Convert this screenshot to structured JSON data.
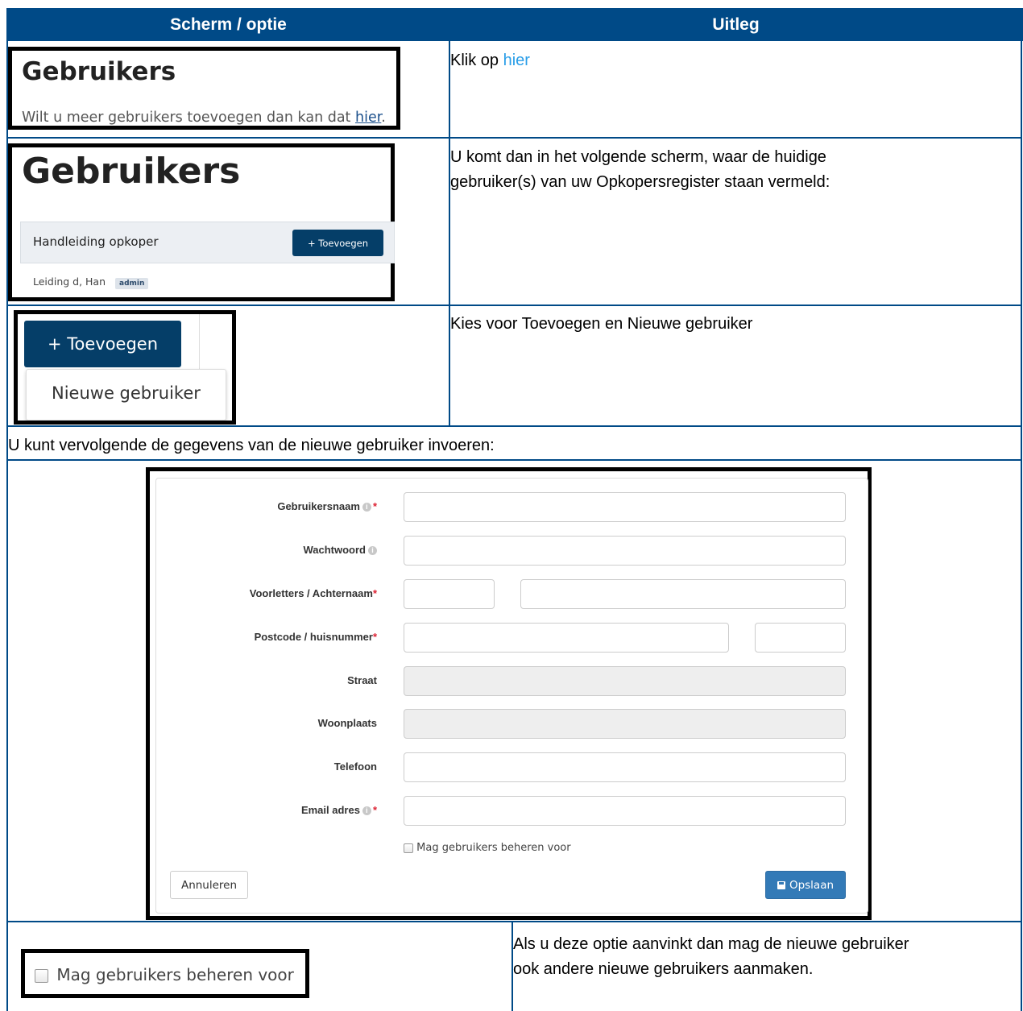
{
  "table": {
    "header": {
      "col1": "Scherm / optie",
      "col2": "Uitleg"
    },
    "row1": {
      "title": "Gebruikers",
      "text_before": "Wilt u meer gebruikers toevoegen dan kan dat ",
      "link": "hier",
      "text_after": ".",
      "explanation_prefix": "Klik op ",
      "explanation_link": "hier"
    },
    "row2": {
      "title": "Gebruikers",
      "group_name": "Handleiding opkoper",
      "add_button": "+ Toevoegen",
      "user_name": "Leiding d, Han",
      "user_badge": "admin",
      "explanation_line1": "U komt dan in het volgende scherm, waar de huidige",
      "explanation_line2": "gebruiker(s) van uw Opkopersregister staan vermeld:"
    },
    "row3": {
      "add_button": "+ Toevoegen",
      "menu_item": "Nieuwe gebruiker",
      "explanation": "Kies voor Toevoegen en Nieuwe gebruiker"
    },
    "row4": {
      "text": "U kunt vervolgende de gegevens van de nieuwe gebruiker invoeren:"
    },
    "form": {
      "username_label": "Gebruikersnaam",
      "password_label": "Wachtwoord",
      "name_label": "Voorletters / Achternaam",
      "postcode_label": "Postcode / huisnummer",
      "street_label": "Straat",
      "city_label": "Woonplaats",
      "phone_label": "Telefoon",
      "email_label": "Email adres",
      "required_mark": "*",
      "info_mark": "i",
      "manage_checkbox_label": "Mag gebruikers beheren voor",
      "cancel_button": "Annuleren",
      "save_button": "Opslaan",
      "save_icon": "floppy-disk-icon"
    },
    "row5": {
      "checkbox_label": "Mag gebruikers beheren voor",
      "explanation_line1": "Als u deze optie aanvinkt dan mag de nieuwe gebruiker",
      "explanation_line2": "ook andere nieuwe gebruikers aanmaken."
    }
  },
  "colors": {
    "table_header": "#004a87",
    "link": "#2a9ee8",
    "navy_button": "#053e68",
    "save_button": "#337ab7"
  }
}
